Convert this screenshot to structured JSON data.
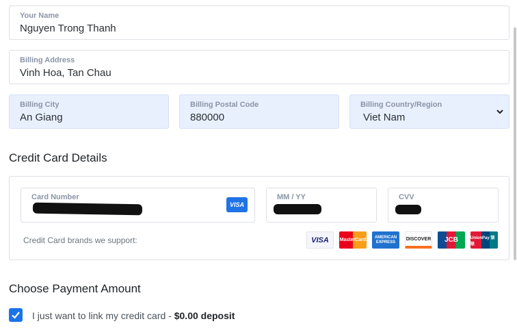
{
  "billing": {
    "name": {
      "label": "Your Name",
      "value": "Nguyen Trong Thanh"
    },
    "address": {
      "label": "Billing Address",
      "value": "Vinh Hoa, Tan Chau"
    },
    "city": {
      "label": "Billing City",
      "value": "An Giang"
    },
    "postal": {
      "label": "Billing Postal Code",
      "value": "880000"
    },
    "country": {
      "label": "Billing Country/Region",
      "value": "Viet Nam"
    }
  },
  "credit_card": {
    "section_title": "Credit Card Details",
    "card_number_label": "Card Number",
    "expiry_label": "MM / YY",
    "cvv_label": "CVV",
    "detected_brand": "VISA",
    "brands_label": "Credit Card brands we support:",
    "brands": [
      "VISA",
      "MasterCard",
      "AMERICAN EXPRESS",
      "DISCOVER",
      "JCB",
      "UnionPay 银联"
    ]
  },
  "payment": {
    "section_title": "Choose Payment Amount",
    "option_text": "I just want to link my credit card - ",
    "option_amount": "$0.00 deposit",
    "checked": true
  },
  "colors": {
    "accent": "#1a73e8",
    "autofill": "#e8f0fe"
  }
}
